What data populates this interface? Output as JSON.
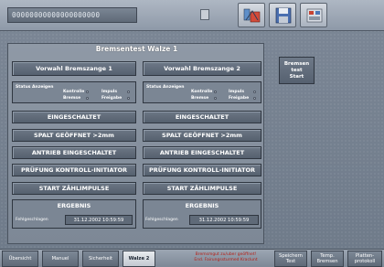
{
  "header": {
    "device_field": "00000000000000000000",
    "icons": [
      "selector-icon",
      "alarm-config-icon",
      "save-icon",
      "settings-icon"
    ]
  },
  "panel": {
    "title": "Bremsentest Walze 1",
    "preselect_left": "Vorwahl Bremszange 1",
    "preselect_right": "Vorwahl Bremszange 2",
    "status": {
      "title": "Status Anzeigen",
      "controls": "Kontrolle",
      "impulse": "Impuls",
      "brake": "Bremse",
      "release": "Freigabe"
    },
    "rows": [
      "EINGESCHALTET",
      "SPALT GEÖFFNET >2mm",
      "ANTRIEB EINGESCHALTET",
      "PRÜFUNG KONTROLL-INITIATOR",
      "START ZÄHLIMPULSE",
      "ERGEBNIS"
    ],
    "result_left": {
      "label": "Fehlgeschlagen",
      "date": "31.12.2002 10:59:59"
    },
    "result_right": {
      "label": "Fehlgeschlagen",
      "date": "31.12.2002 10:59:59"
    }
  },
  "start_button": "Bremsen\ntest\nStart",
  "footer": {
    "nav": [
      "Übersicht",
      "Manuel",
      "Sicherheit",
      "Walze 2"
    ],
    "alarm": "Bremsmgut zu/uber geöffnet!\nEnd. Fairungssturmed Kraclunt",
    "actions": [
      "Speichern\nTest",
      "Temp.\nBremsen",
      "Platten-\nprotokoll"
    ]
  },
  "colors": {
    "background": "#6f7b8a",
    "button": "#5f6a78",
    "active_tab": "#e8ebef",
    "alarm_text": "#b52018"
  }
}
